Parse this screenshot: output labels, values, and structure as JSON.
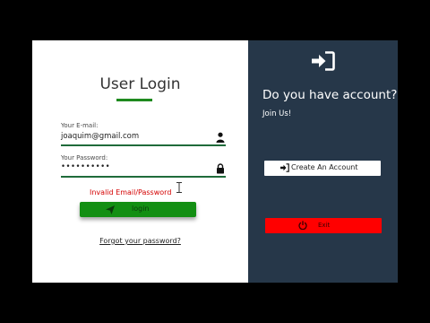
{
  "login": {
    "title": "User Login",
    "email_label": "Your E-mail:",
    "email_value": "joaquim@gmail.com",
    "password_label": "Your Password:",
    "password_value": "••••••••••",
    "error_message": "Invalid Email/Password",
    "login_button": "login",
    "forgot_link": "Forgot your password?"
  },
  "account": {
    "title": "Do you have account?",
    "subtitle": "Join Us!",
    "create_button": "Create An Account",
    "exit_button": "Exit"
  },
  "colors": {
    "accent_green": "#138f13",
    "panel_dark": "#263749",
    "error_red": "#d40000",
    "exit_red": "#ff0000"
  },
  "icons": {
    "enter": "sign-in-icon",
    "user": "user-icon",
    "lock": "lock-icon",
    "send": "paper-plane-icon",
    "power": "power-icon"
  }
}
